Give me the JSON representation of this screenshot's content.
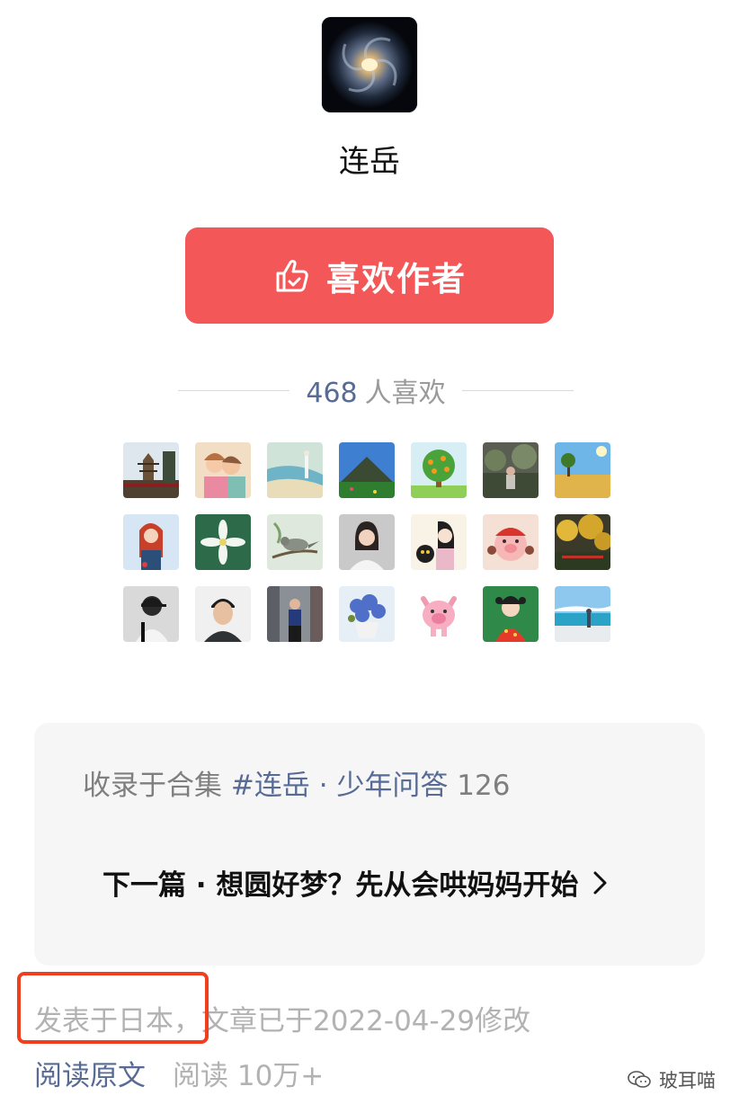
{
  "author": {
    "name": "连岳",
    "avatar_icon": "galaxy-avatar"
  },
  "like_button": {
    "label": "喜欢作者",
    "icon": "thumbs-up-icon",
    "color": "#f45757"
  },
  "likes": {
    "count": "468",
    "unit": "人喜欢"
  },
  "likers": [
    {
      "name": "liker-avatar-pagoda"
    },
    {
      "name": "liker-avatar-couple-illustration"
    },
    {
      "name": "liker-avatar-beach-painting"
    },
    {
      "name": "liker-avatar-mountain"
    },
    {
      "name": "liker-avatar-orange-tree"
    },
    {
      "name": "liker-avatar-garden"
    },
    {
      "name": "liker-avatar-wheat-field"
    },
    {
      "name": "liker-avatar-red-hair-girl"
    },
    {
      "name": "liker-avatar-white-flower"
    },
    {
      "name": "liker-avatar-bird"
    },
    {
      "name": "liker-avatar-woman-portrait"
    },
    {
      "name": "liker-avatar-girl-with-cat"
    },
    {
      "name": "liker-avatar-pig-girl"
    },
    {
      "name": "liker-avatar-golden-trees"
    },
    {
      "name": "liker-avatar-cap-back"
    },
    {
      "name": "liker-avatar-man-portrait"
    },
    {
      "name": "liker-avatar-city-walk"
    },
    {
      "name": "liker-avatar-blue-flowers"
    },
    {
      "name": "liker-avatar-pink-pig"
    },
    {
      "name": "liker-avatar-red-dress-girl"
    },
    {
      "name": "liker-avatar-seaside"
    }
  ],
  "collection": {
    "prefix": "收录于合集",
    "tag": "#连岳 · 少年问答",
    "count": "126",
    "next_label": "下一篇 · 想圆好梦？先从会哄妈妈开始"
  },
  "meta": {
    "text": "发表于日本，文章已于2022-04-29修改"
  },
  "footer": {
    "read_original": "阅读原文",
    "read_count": "阅读 10万+"
  },
  "watermark": {
    "text": "玻耳喵",
    "icon": "wechat-icon"
  },
  "colors": {
    "link": "#576b95",
    "muted": "#b2b2b2",
    "highlight": "#f23d1e"
  }
}
